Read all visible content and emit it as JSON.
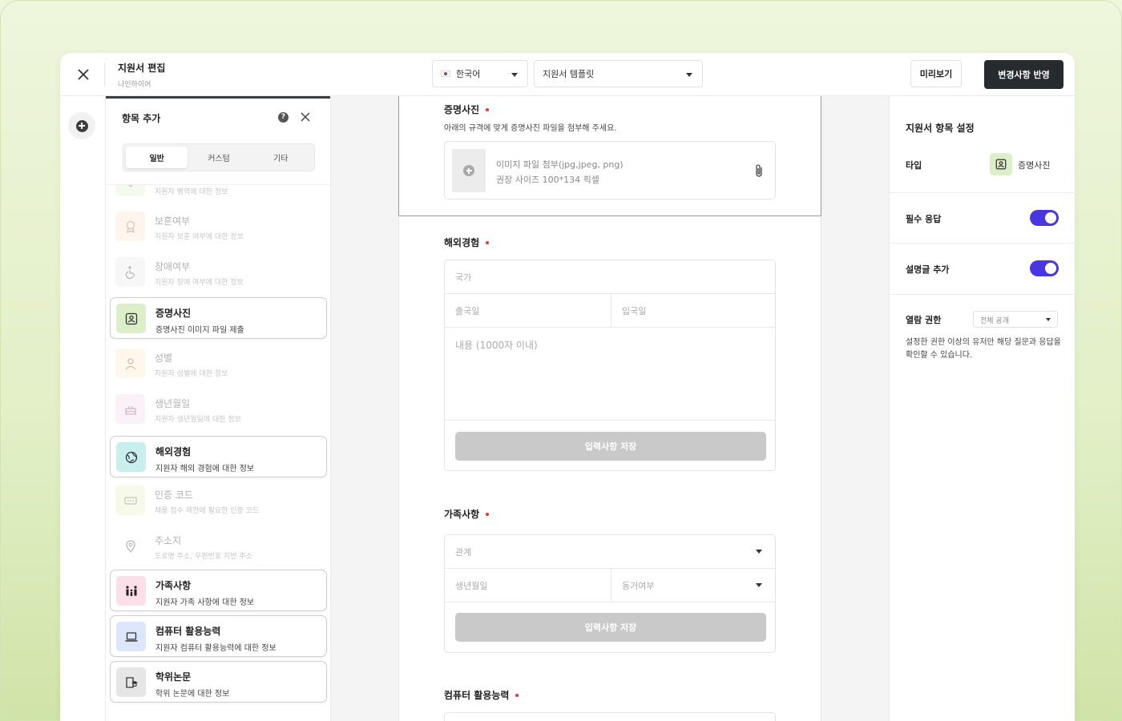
{
  "header": {
    "title": "지원서 편집",
    "subtitle": "나인하이어",
    "language": "한국어",
    "template": "지원서 템플릿",
    "preview_label": "미리보기",
    "apply_label": "변경사항 반영"
  },
  "add_panel": {
    "title": "항목 추가",
    "tabs": [
      {
        "label": "일반",
        "active": true
      },
      {
        "label": "커스텀",
        "active": false
      },
      {
        "label": "기타",
        "active": false
      }
    ],
    "items": [
      {
        "name": "",
        "desc": "지원자 병역에 대한 정보",
        "icon": "military-icon",
        "active": false
      },
      {
        "name": "보훈여부",
        "desc": "지원자 보훈 여부에 대한 정보",
        "icon": "medal-icon",
        "active": false
      },
      {
        "name": "장애여부",
        "desc": "지원자 장애 여부에 대한 정보",
        "icon": "wheelchair-icon",
        "active": false
      },
      {
        "name": "증명사진",
        "desc": "증명사진 이미지 파일 제출",
        "icon": "id-photo-icon",
        "active": true
      },
      {
        "name": "성별",
        "desc": "지원자 성별에 대한 정보",
        "icon": "person-icon",
        "active": false
      },
      {
        "name": "생년월일",
        "desc": "지원자 생년월일에 대한 정보",
        "icon": "cake-icon",
        "active": false
      },
      {
        "name": "해외경험",
        "desc": "지원자 해외 경험에 대한 정보",
        "icon": "globe-icon",
        "active": true
      },
      {
        "name": "인증 코드",
        "desc": "채용 접수 제한에 필요한 인증 코드",
        "icon": "code-icon",
        "active": false
      },
      {
        "name": "주소지",
        "desc": "도로명 주소, 우편번호 지번 주소",
        "icon": "location-pin-icon",
        "active": false
      },
      {
        "name": "가족사항",
        "desc": "지원자 가족 사항에 대한 정보",
        "icon": "family-icon",
        "active": true
      },
      {
        "name": "컴퓨터 활용능력",
        "desc": "지원자 컴퓨터 활용능력에 대한 정보",
        "icon": "laptop-icon",
        "active": true
      },
      {
        "name": "학위논문",
        "desc": "학위 논문에 대한 정보",
        "icon": "thesis-icon",
        "active": true
      }
    ],
    "colors": {
      "military": "#e8f4e0",
      "medal": "#fde9d9",
      "wheelchair": "#eeeeee",
      "id_photo": "#dcefc8",
      "person": "#fdf0d2",
      "cake": "#f6e1ee",
      "globe": "#c9eeee",
      "code": "#eef3cf",
      "pin": "#eeeeee",
      "family": "#fbe0ea",
      "laptop": "#dde6fa",
      "thesis": "#e6e6e6"
    }
  },
  "form": {
    "photo": {
      "title": "증명사진",
      "desc": "아래의 규격에 맞게 증명사진 파일을 첨부해 주세요.",
      "upload_line1": "이미지 파일 첨부(jpg,jpeg, png)",
      "upload_line2": "권장 사이즈 100*134 픽셀"
    },
    "overseas": {
      "title": "해외경험",
      "country_ph": "국가",
      "departure_ph": "출국일",
      "entry_ph": "입국일",
      "content_ph": "내용 (1000자 이내)",
      "save_label": "입력사항 저장"
    },
    "family": {
      "title": "가족사항",
      "relation_ph": "관계",
      "birth_ph": "생년월일",
      "cohab_ph": "동거여부",
      "save_label": "입력사항 저장"
    },
    "computer": {
      "title": "컴퓨터 활용능력"
    }
  },
  "settings": {
    "title": "지원서 항목 설정",
    "type_label": "타입",
    "type_value": "증명사진",
    "required_label": "필수 응답",
    "required_on": true,
    "desc_label": "설명글 추가",
    "desc_on": true,
    "view_label": "열람 권한",
    "view_value": "전체 공개",
    "view_desc": "설정한 권한 이상의 유저만 해당 질문과 응답을 확인할 수 있습니다.",
    "accent_color": "#4a36e0"
  }
}
